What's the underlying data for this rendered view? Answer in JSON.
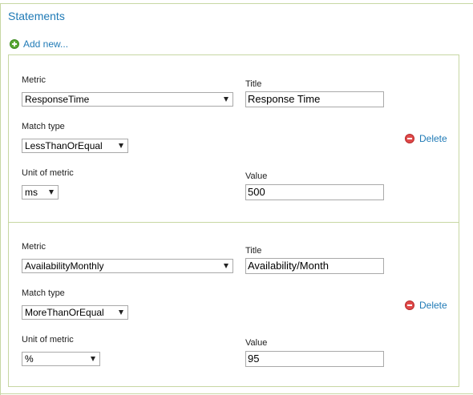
{
  "section": {
    "title": "Statements"
  },
  "add_new": {
    "label": "Add new...",
    "icon": "plus-circle-icon"
  },
  "colors": {
    "link": "#1f7ab6",
    "border": "#c7d7a3",
    "delete_icon": "#e04a4a",
    "add_icon": "#5aa834"
  },
  "statements": [
    {
      "metric_label": "Metric",
      "metric_value": "ResponseTime",
      "title_label": "Title",
      "title_value": "Response Time",
      "match_type_label": "Match type",
      "match_type_value": "LessThanOrEqual",
      "unit_label": "Unit of metric",
      "unit_value": "ms",
      "value_label": "Value",
      "value_value": "500",
      "delete_label": "Delete"
    },
    {
      "metric_label": "Metric",
      "metric_value": "AvailabilityMonthly",
      "title_label": "Title",
      "title_value": "Availability/Month",
      "match_type_label": "Match type",
      "match_type_value": "MoreThanOrEqual",
      "unit_label": "Unit of metric",
      "unit_value": "%",
      "value_label": "Value",
      "value_value": "95",
      "delete_label": "Delete"
    }
  ]
}
